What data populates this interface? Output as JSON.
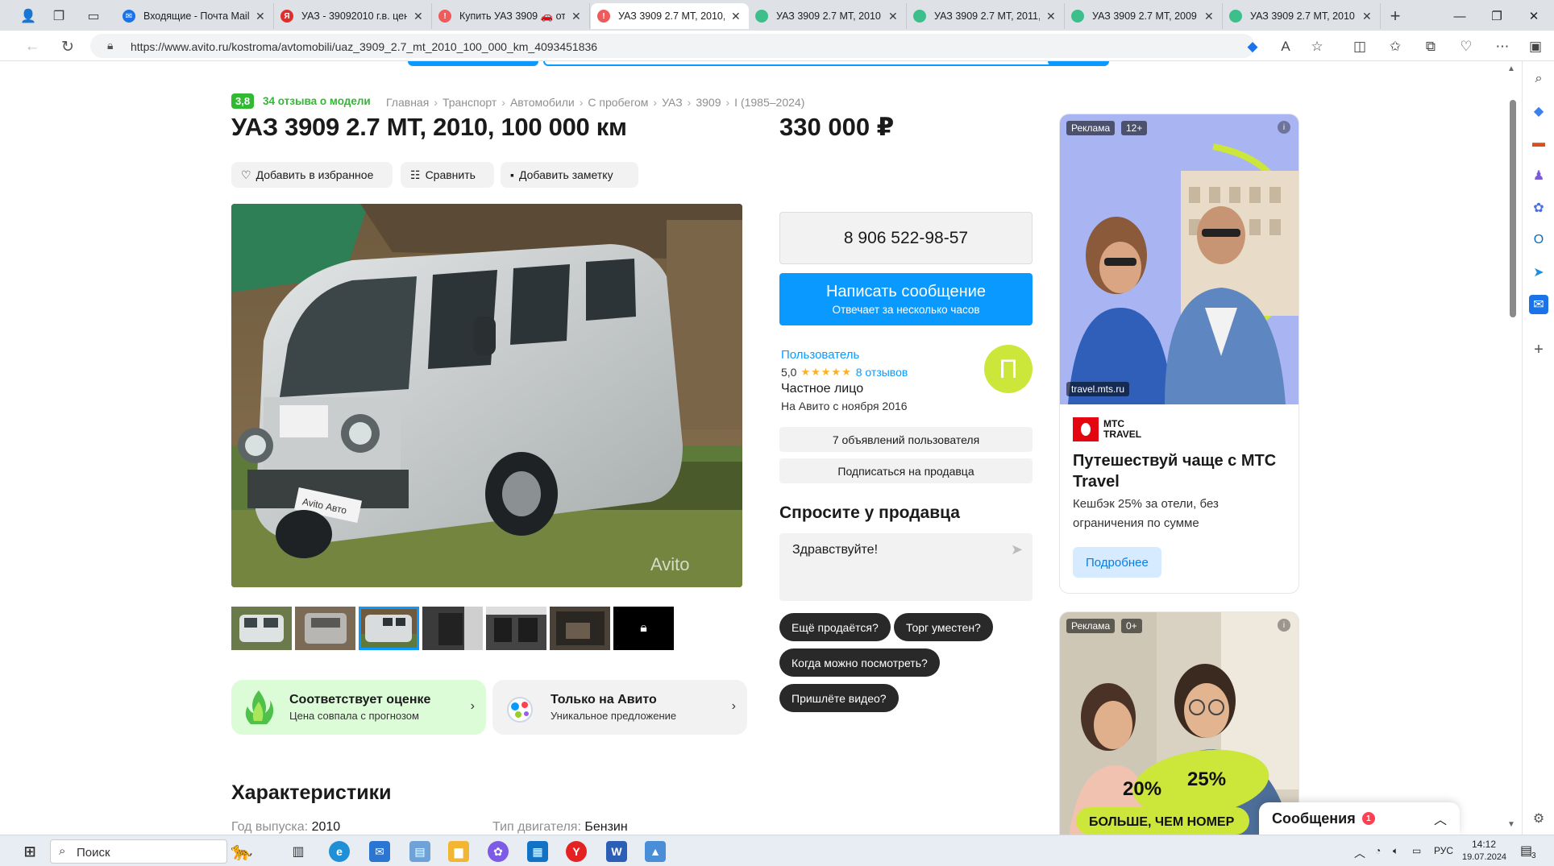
{
  "browser": {
    "tabs": [
      {
        "title": "Входящие - Почта Mail.",
        "favicon_color": "#1a73e8"
      },
      {
        "title": "УАЗ - 39092010 г.в. цен",
        "favicon_color": "#e22d2d"
      },
      {
        "title": "Купить УАЗ 3909 🚗 от",
        "favicon_color": "#ef5a5a"
      },
      {
        "title": "УАЗ 3909 2.7 MT, 2010,",
        "favicon_color": "#ef5a5a"
      },
      {
        "title": "УАЗ 3909 2.7 MT, 2010,",
        "favicon_color": "#3cbf8a"
      },
      {
        "title": "УАЗ 3909 2.7 MT, 2011,",
        "favicon_color": "#3cbf8a"
      },
      {
        "title": "УАЗ 3909 2.7 MT, 2009,",
        "favicon_color": "#3cbf8a"
      },
      {
        "title": "УАЗ 3909 2.7 MT, 2010,",
        "favicon_color": "#3cbf8a"
      }
    ],
    "url": "https://www.avito.ru/kostroma/avtomobili/uaz_3909_2.7_mt_2010_100_000_km_4093451836"
  },
  "listing": {
    "rating": "3,8",
    "reviews_link": "34 отзыва о модели",
    "breadcrumb": [
      "Главная",
      "Транспорт",
      "Автомобили",
      "С пробегом",
      "УАЗ",
      "3909",
      "I (1985–2024)"
    ],
    "title": "УАЗ 3909 2.7 MT, 2010, 100 000 км",
    "price": "330 000 ₽",
    "actions": {
      "favorite": "Добавить в избранное",
      "compare": "Сравнить",
      "note": "Добавить заметку"
    },
    "photo_watermark": "Avito",
    "photo_plate": "Avito Авто",
    "promos": [
      {
        "title": "Соответствует оценке",
        "subtitle": "Цена совпала с прогнозом"
      },
      {
        "title": "Только на Авито",
        "subtitle": "Уникальное предложение"
      }
    ],
    "characteristics": {
      "heading": "Характеристики",
      "year_label": "Год выпуска:",
      "year_value": "2010",
      "engine_label": "Тип двигателя:",
      "engine_value": "Бензин"
    }
  },
  "seller": {
    "phone": "8 906 522-98-57",
    "message_btn": "Написать сообщение",
    "message_sub": "Отвечает за несколько часов",
    "name": "Пользователь",
    "score": "5,0",
    "stars": "★★★★★",
    "reviews": "8 отзывов",
    "type": "Частное лицо",
    "since": "На Авито с ноября 2016",
    "avatar_letter": "П",
    "listings_btn": "7 объявлений пользователя",
    "subscribe_btn": "Подписаться на продавца"
  },
  "ask": {
    "title": "Спросите у продавца",
    "text": "Здравствуйте!",
    "chips": [
      "Ещё продаётся?",
      "Торг уместен?",
      "Когда можно посмотреть?",
      "Пришлёте видео?"
    ]
  },
  "ads": [
    {
      "label": "Реклама",
      "age": "12+",
      "domain": "travel.mts.ru",
      "brand_1": "МТС",
      "brand_2": "TRAVEL",
      "title": "Путешествуй чаще с МТС Travel",
      "text": "Кешбэк 25% за отели, без ограничения по сумме",
      "cta": "Подробнее"
    },
    {
      "label": "Реклама",
      "age": "0+",
      "badge_1": "20%",
      "badge_2": "25%",
      "banner": "БОЛЬШЕ, ЧЕМ НОМЕР"
    }
  ],
  "messages_panel": {
    "title": "Сообщения",
    "count": "1"
  },
  "taskbar": {
    "search": "Поиск",
    "lang": "РУС",
    "time": "14:12",
    "date": "19.07.2024",
    "notif_count": "3"
  },
  "colors": {
    "accent": "#0a9aff",
    "green": "#32b932",
    "avatar": "#cde63a"
  }
}
